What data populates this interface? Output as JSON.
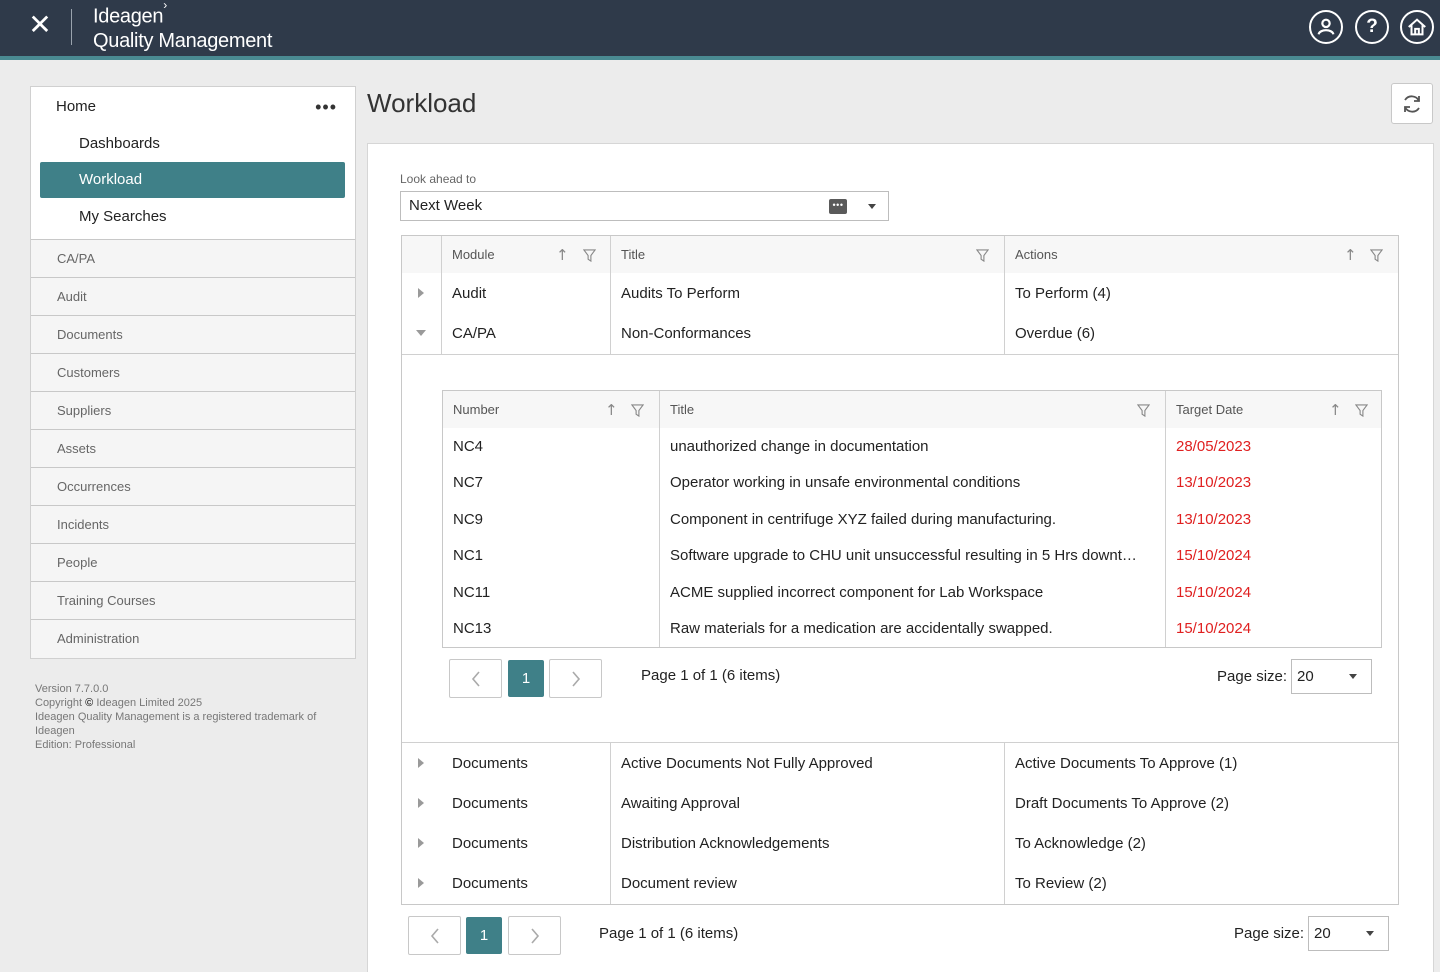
{
  "header": {
    "close_glyph": "✕",
    "brand_line1": "Ideagen",
    "brand_mark": "›",
    "brand_line2": "Quality Management",
    "help_glyph": "?"
  },
  "sidebar": {
    "home_label": "Home",
    "more_glyph": "•••",
    "sub_items": [
      "Dashboards",
      "Workload",
      "My Searches"
    ],
    "active_item": "Workload",
    "modules": [
      "CA/PA",
      "Audit",
      "Documents",
      "Customers",
      "Suppliers",
      "Assets",
      "Occurrences",
      "Incidents",
      "People",
      "Training Courses",
      "Administration"
    ]
  },
  "version": {
    "line1": "Version 7.7.0.0",
    "line2_prefix": "Copyright",
    "copyright_glyph": "©",
    "line2_suffix": "Ideagen Limited 2025",
    "line3": "Ideagen Quality Management is a registered trademark of Ideagen",
    "line4": "Edition: Professional"
  },
  "page": {
    "title": "Workload"
  },
  "lookahead": {
    "label": "Look ahead to",
    "value": "Next Week",
    "calendar_glyph": "•••"
  },
  "outer_grid": {
    "columns": [
      "Module",
      "Title",
      "Actions"
    ],
    "rows_top": [
      {
        "module": "Audit",
        "title": "Audits To Perform",
        "actions": "To Perform (4)"
      },
      {
        "module": "CA/PA",
        "title": "Non-Conformances",
        "actions": "Overdue (6)"
      }
    ],
    "rows_bottom": [
      {
        "module": "Documents",
        "title": "Active Documents Not Fully Approved",
        "actions": "Active Documents To Approve (1)"
      },
      {
        "module": "Documents",
        "title": "Awaiting Approval",
        "actions": "Draft Documents To Approve (2)"
      },
      {
        "module": "Documents",
        "title": "Distribution Acknowledgements",
        "actions": "To Acknowledge (2)"
      },
      {
        "module": "Documents",
        "title": "Document review",
        "actions": "To Review (2)"
      }
    ],
    "pager": {
      "page": "1",
      "info": "Page 1 of 1 (6 items)",
      "size_label": "Page size:",
      "size_value": "20"
    }
  },
  "inner_grid": {
    "columns": [
      "Number",
      "Title",
      "Target Date"
    ],
    "rows": [
      {
        "number": "NC4",
        "title": "unauthorized change in documentation",
        "date": "28/05/2023"
      },
      {
        "number": "NC7",
        "title": "Operator working in unsafe environmental conditions",
        "date": "13/10/2023"
      },
      {
        "number": "NC9",
        "title": "Component in centrifuge XYZ failed during manufacturing.",
        "date": "13/10/2023"
      },
      {
        "number": "NC1",
        "title": "Software upgrade to CHU unit unsuccessful resulting in 5 Hrs downt…",
        "date": "15/10/2024"
      },
      {
        "number": "NC11",
        "title": "ACME supplied incorrect component for Lab Workspace",
        "date": "15/10/2024"
      },
      {
        "number": "NC13",
        "title": "Raw materials for a medication are accidentally swapped.",
        "date": "15/10/2024"
      }
    ],
    "pager": {
      "page": "1",
      "info": "Page 1 of 1 (6 items)",
      "size_label": "Page size:",
      "size_value": "20"
    }
  },
  "colors": {
    "header_bg": "#2f3a4a",
    "accent": "#3f8088",
    "overdue_red": "#e02020"
  }
}
